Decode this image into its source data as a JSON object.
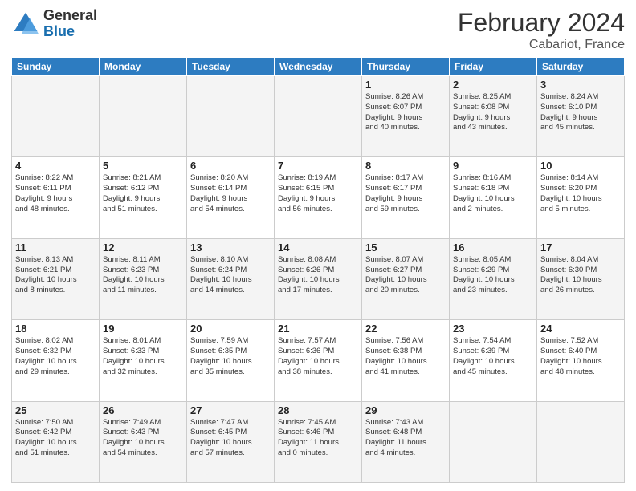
{
  "header": {
    "logo_general": "General",
    "logo_blue": "Blue",
    "title": "February 2024",
    "subtitle": "Cabariot, France"
  },
  "weekdays": [
    "Sunday",
    "Monday",
    "Tuesday",
    "Wednesday",
    "Thursday",
    "Friday",
    "Saturday"
  ],
  "weeks": [
    [
      {
        "day": "",
        "info": ""
      },
      {
        "day": "",
        "info": ""
      },
      {
        "day": "",
        "info": ""
      },
      {
        "day": "",
        "info": ""
      },
      {
        "day": "1",
        "info": "Sunrise: 8:26 AM\nSunset: 6:07 PM\nDaylight: 9 hours\nand 40 minutes."
      },
      {
        "day": "2",
        "info": "Sunrise: 8:25 AM\nSunset: 6:08 PM\nDaylight: 9 hours\nand 43 minutes."
      },
      {
        "day": "3",
        "info": "Sunrise: 8:24 AM\nSunset: 6:10 PM\nDaylight: 9 hours\nand 45 minutes."
      }
    ],
    [
      {
        "day": "4",
        "info": "Sunrise: 8:22 AM\nSunset: 6:11 PM\nDaylight: 9 hours\nand 48 minutes."
      },
      {
        "day": "5",
        "info": "Sunrise: 8:21 AM\nSunset: 6:12 PM\nDaylight: 9 hours\nand 51 minutes."
      },
      {
        "day": "6",
        "info": "Sunrise: 8:20 AM\nSunset: 6:14 PM\nDaylight: 9 hours\nand 54 minutes."
      },
      {
        "day": "7",
        "info": "Sunrise: 8:19 AM\nSunset: 6:15 PM\nDaylight: 9 hours\nand 56 minutes."
      },
      {
        "day": "8",
        "info": "Sunrise: 8:17 AM\nSunset: 6:17 PM\nDaylight: 9 hours\nand 59 minutes."
      },
      {
        "day": "9",
        "info": "Sunrise: 8:16 AM\nSunset: 6:18 PM\nDaylight: 10 hours\nand 2 minutes."
      },
      {
        "day": "10",
        "info": "Sunrise: 8:14 AM\nSunset: 6:20 PM\nDaylight: 10 hours\nand 5 minutes."
      }
    ],
    [
      {
        "day": "11",
        "info": "Sunrise: 8:13 AM\nSunset: 6:21 PM\nDaylight: 10 hours\nand 8 minutes."
      },
      {
        "day": "12",
        "info": "Sunrise: 8:11 AM\nSunset: 6:23 PM\nDaylight: 10 hours\nand 11 minutes."
      },
      {
        "day": "13",
        "info": "Sunrise: 8:10 AM\nSunset: 6:24 PM\nDaylight: 10 hours\nand 14 minutes."
      },
      {
        "day": "14",
        "info": "Sunrise: 8:08 AM\nSunset: 6:26 PM\nDaylight: 10 hours\nand 17 minutes."
      },
      {
        "day": "15",
        "info": "Sunrise: 8:07 AM\nSunset: 6:27 PM\nDaylight: 10 hours\nand 20 minutes."
      },
      {
        "day": "16",
        "info": "Sunrise: 8:05 AM\nSunset: 6:29 PM\nDaylight: 10 hours\nand 23 minutes."
      },
      {
        "day": "17",
        "info": "Sunrise: 8:04 AM\nSunset: 6:30 PM\nDaylight: 10 hours\nand 26 minutes."
      }
    ],
    [
      {
        "day": "18",
        "info": "Sunrise: 8:02 AM\nSunset: 6:32 PM\nDaylight: 10 hours\nand 29 minutes."
      },
      {
        "day": "19",
        "info": "Sunrise: 8:01 AM\nSunset: 6:33 PM\nDaylight: 10 hours\nand 32 minutes."
      },
      {
        "day": "20",
        "info": "Sunrise: 7:59 AM\nSunset: 6:35 PM\nDaylight: 10 hours\nand 35 minutes."
      },
      {
        "day": "21",
        "info": "Sunrise: 7:57 AM\nSunset: 6:36 PM\nDaylight: 10 hours\nand 38 minutes."
      },
      {
        "day": "22",
        "info": "Sunrise: 7:56 AM\nSunset: 6:38 PM\nDaylight: 10 hours\nand 41 minutes."
      },
      {
        "day": "23",
        "info": "Sunrise: 7:54 AM\nSunset: 6:39 PM\nDaylight: 10 hours\nand 45 minutes."
      },
      {
        "day": "24",
        "info": "Sunrise: 7:52 AM\nSunset: 6:40 PM\nDaylight: 10 hours\nand 48 minutes."
      }
    ],
    [
      {
        "day": "25",
        "info": "Sunrise: 7:50 AM\nSunset: 6:42 PM\nDaylight: 10 hours\nand 51 minutes."
      },
      {
        "day": "26",
        "info": "Sunrise: 7:49 AM\nSunset: 6:43 PM\nDaylight: 10 hours\nand 54 minutes."
      },
      {
        "day": "27",
        "info": "Sunrise: 7:47 AM\nSunset: 6:45 PM\nDaylight: 10 hours\nand 57 minutes."
      },
      {
        "day": "28",
        "info": "Sunrise: 7:45 AM\nSunset: 6:46 PM\nDaylight: 11 hours\nand 0 minutes."
      },
      {
        "day": "29",
        "info": "Sunrise: 7:43 AM\nSunset: 6:48 PM\nDaylight: 11 hours\nand 4 minutes."
      },
      {
        "day": "",
        "info": ""
      },
      {
        "day": "",
        "info": ""
      }
    ]
  ]
}
